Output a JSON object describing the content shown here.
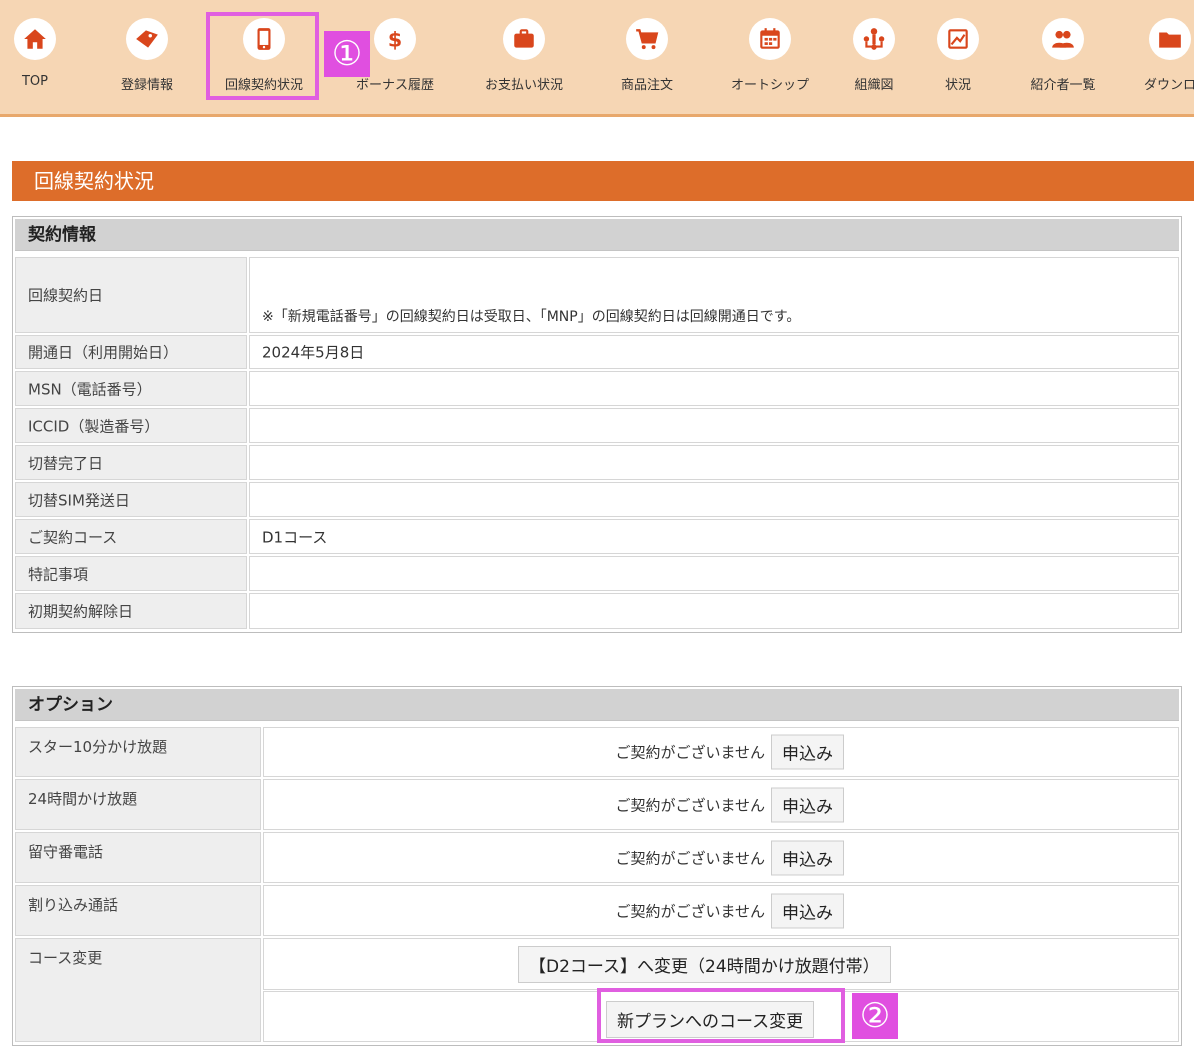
{
  "nav": {
    "items": [
      {
        "label": "TOP",
        "icon": "home-icon"
      },
      {
        "label": "登録情報",
        "icon": "tag-icon"
      },
      {
        "label": "回線契約状況",
        "icon": "phone-icon"
      },
      {
        "label": "ボーナス履歴",
        "icon": "dollar-icon"
      },
      {
        "label": "お支払い状況",
        "icon": "briefcase-icon"
      },
      {
        "label": "商品注文",
        "icon": "cart-icon"
      },
      {
        "label": "オートシップ",
        "icon": "calendar-icon"
      },
      {
        "label": "組織図",
        "icon": "org-chart-icon"
      },
      {
        "label": "状況",
        "icon": "chart-icon"
      },
      {
        "label": "紹介者一覧",
        "icon": "users-icon"
      },
      {
        "label": "ダウンロ",
        "icon": "folder-icon"
      }
    ]
  },
  "annotations": {
    "step1": "①",
    "step2": "②"
  },
  "page_title": "回線契約状況",
  "contract": {
    "heading": "契約情報",
    "note": "※「新規電話番号」の回線契約日は受取日、「MNP」の回線契約日は回線開通日です。",
    "rows": [
      {
        "label": "回線契約日",
        "value": ""
      },
      {
        "label": "開通日（利用開始日）",
        "value": "2024年5月8日"
      },
      {
        "label": "MSN（電話番号）",
        "value": ""
      },
      {
        "label": "ICCID（製造番号）",
        "value": ""
      },
      {
        "label": "切替完了日",
        "value": ""
      },
      {
        "label": "切替SIM発送日",
        "value": ""
      },
      {
        "label": "ご契約コース",
        "value": "D1コース"
      },
      {
        "label": "特記事項",
        "value": ""
      },
      {
        "label": "初期契約解除日",
        "value": ""
      }
    ]
  },
  "options": {
    "heading": "オプション",
    "rows": [
      {
        "label": "スター10分かけ放題",
        "status": "ご契約がございません",
        "button": "申込み"
      },
      {
        "label": "24時間かけ放題",
        "status": "ご契約がございません",
        "button": "申込み"
      },
      {
        "label": "留守番電話",
        "status": "ご契約がございません",
        "button": "申込み"
      },
      {
        "label": "割り込み通話",
        "status": "ご契約がございません",
        "button": "申込み"
      }
    ],
    "course_change": {
      "label": "コース変更",
      "button_d2": "【D2コース】へ変更（24時間かけ放題付帯）",
      "button_new_plan": "新プランへのコース変更"
    }
  },
  "colors": {
    "accent": "#dd6d2a",
    "nav_bg": "#f6d6b4",
    "icon_red": "#d9461c",
    "highlight": "#e05fe0"
  }
}
